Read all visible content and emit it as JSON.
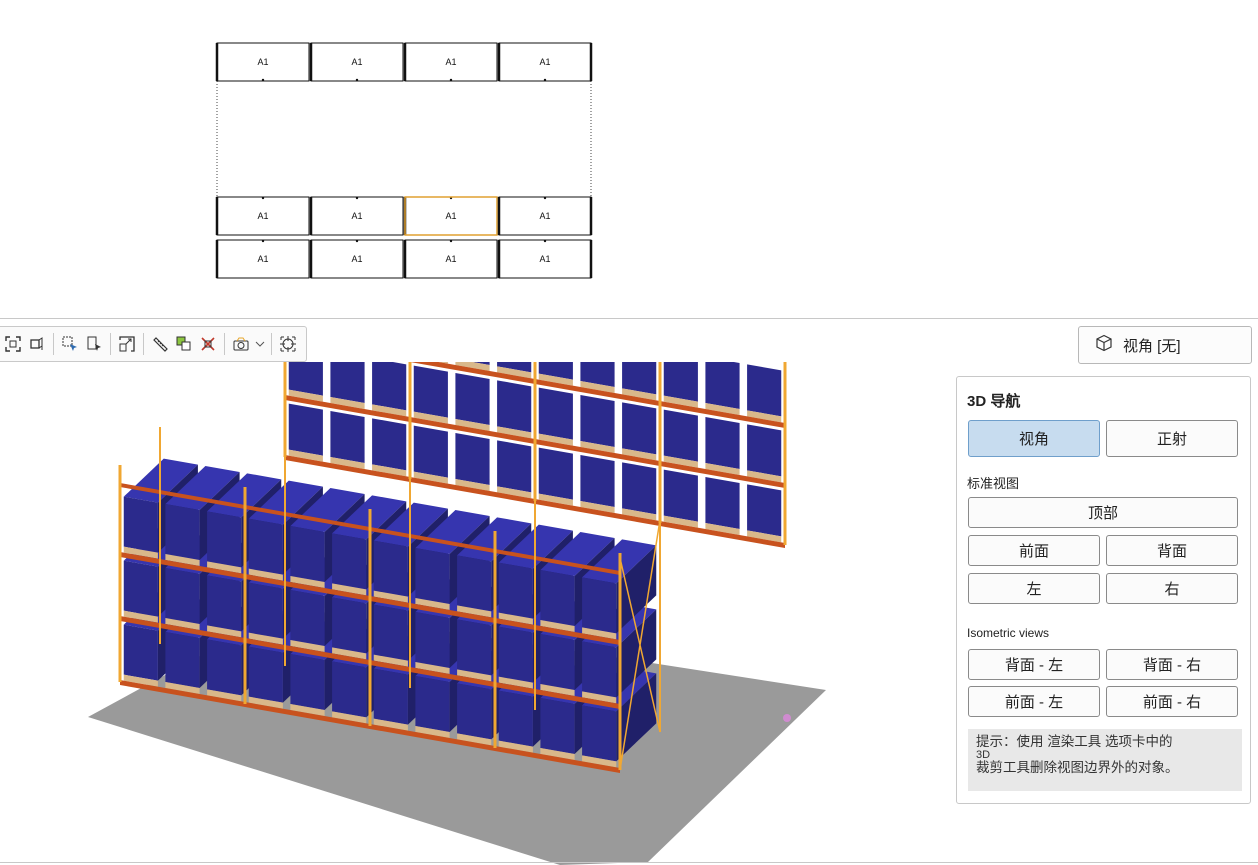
{
  "plan": {
    "cell_label": "A1",
    "rows": [
      [
        "A1",
        "A1",
        "A1",
        "A1"
      ],
      [
        "A1",
        "A1",
        "A1",
        "A1"
      ],
      [
        "A1",
        "A1",
        "A1",
        "A1"
      ]
    ],
    "selected": {
      "row": 1,
      "col": 2
    }
  },
  "toolbar": {
    "icons": [
      "zoom-extents-icon",
      "zoom-window-icon",
      "select-icon",
      "select-by-label-icon",
      "fit-view-icon",
      "measure-icon",
      "copy-icon",
      "delete-icon",
      "camera-icon",
      "dropdown-chevron-icon",
      "center-view-icon"
    ]
  },
  "view_button": {
    "label": "视角 [无]",
    "icon": "cube-icon"
  },
  "nav": {
    "title": "3D 导航",
    "perspective": "视角",
    "orthographic": "正射",
    "standard_views_label": "标准视图",
    "top": "顶部",
    "front": "前面",
    "back": "背面",
    "left": "左",
    "right": "右",
    "isometric_label": "Isometric views",
    "back_left": "背面 - 左",
    "back_right": "背面 - 右",
    "front_left": "前面 - 左",
    "front_right": "前面 - 右",
    "tip_line1": "提示：使用 渲染工具 选项卡中的",
    "tip_line2": "3D",
    "tip_line3": "裁剪工具删除视图边界外的对象。"
  },
  "colors": {
    "pallet": "#2b2a8c",
    "upright": "#f0a732",
    "beam": "#c8521e",
    "floor": "#9a9a9a",
    "active_button": "#c7dcef"
  }
}
